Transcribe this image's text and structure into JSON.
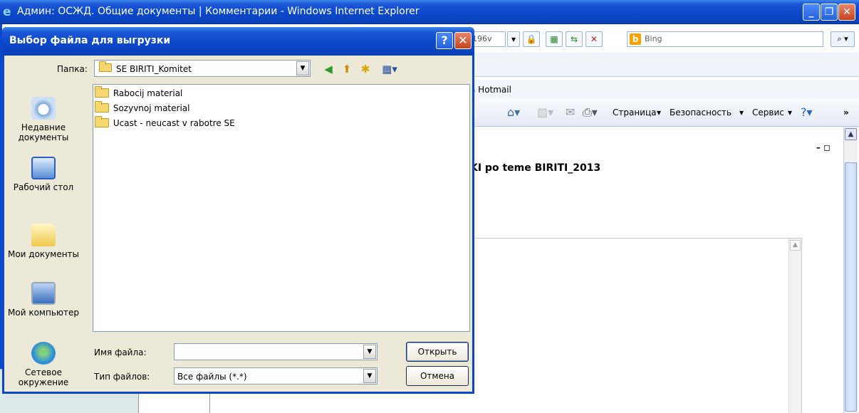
{
  "browser": {
    "window_title": "Админ: ОСЖД. Общие документы | Комментарии - Windows Internet Explorer",
    "address_fragment": "196v",
    "search_placeholder": "Bing",
    "favorites_link": "a Hotmail",
    "command_bar": {
      "page_menu": "Страница",
      "security_menu": "Безопасность",
      "tools_menu": "Сервис"
    },
    "content": {
      "heading": "KI po teme BIRITI_2013"
    }
  },
  "dialog": {
    "title": "Выбор файла для выгрузки",
    "folder_label": "Папка:",
    "current_folder": "SE BIRITI_Komitet",
    "places": [
      {
        "label": "Недавние документы",
        "icon": "recent-documents-icon"
      },
      {
        "label": "Рабочий стол",
        "icon": "desktop-icon"
      },
      {
        "label": "Мои документы",
        "icon": "my-documents-icon"
      },
      {
        "label": "Мой компьютер",
        "icon": "my-computer-icon"
      },
      {
        "label": "Сетевое окружение",
        "icon": "network-places-icon"
      }
    ],
    "files": [
      {
        "name": "Rabocij material"
      },
      {
        "name": "Sozyvnoj material"
      },
      {
        "name": "Ucast - neucast v rabotre SE"
      }
    ],
    "filename_label": "Имя файла:",
    "filename_value": "",
    "filetype_label": "Тип файлов:",
    "filetype_value": "Все файлы (*.*)",
    "open_button": "Открыть",
    "cancel_button": "Отмена"
  },
  "colors": {
    "titlebar": "#0a47c9",
    "dialog_face": "#ece9d8",
    "folder": "#f6d66e"
  }
}
